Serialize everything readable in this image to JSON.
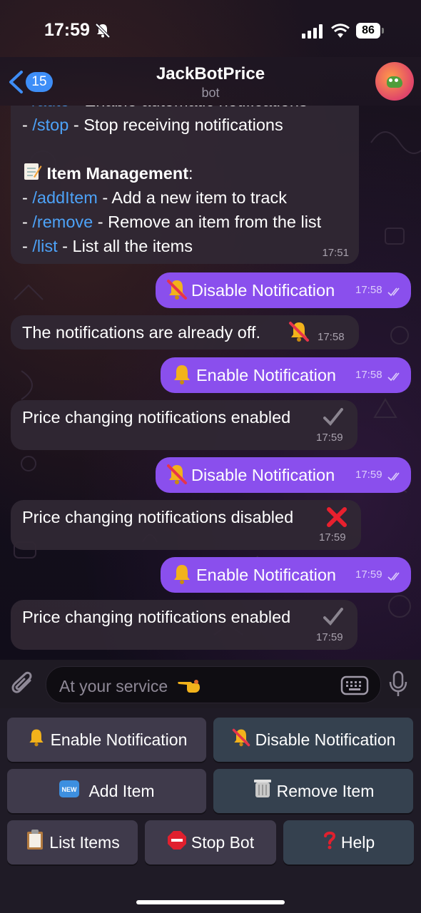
{
  "status_bar": {
    "time": "17:59",
    "battery": "86"
  },
  "header": {
    "back_count": "15",
    "title": "JackBotPrice",
    "subtitle": "bot"
  },
  "messages": {
    "help": {
      "line0_cmd": "/auto",
      "line0_text": " - Enable automatic notifications",
      "line1_cmd": "/stop",
      "line1_text": " - Stop receiving notifications",
      "section_title": "Item Management",
      "section_colon": ":",
      "line2_cmd": "/addItem",
      "line2_text": " - Add a new item to track",
      "line3_cmd": "/remove",
      "line3_text": " - Remove an item from the list",
      "line4_cmd": "/list",
      "line4_text": " - List all the items",
      "time": "17:51"
    },
    "m1": {
      "text": "Disable Notification",
      "time": "17:58"
    },
    "m2": {
      "text": "The notifications are already off.",
      "time": "17:58"
    },
    "m3": {
      "text": "Enable Notification",
      "time": "17:58"
    },
    "m4": {
      "text": "Price changing notifications enabled",
      "time": "17:59"
    },
    "m5": {
      "text": "Disable Notification",
      "time": "17:59"
    },
    "m6": {
      "text": "Price changing notifications disabled",
      "time": "17:59"
    },
    "m7": {
      "text": "Enable Notification",
      "time": "17:59"
    },
    "m8": {
      "text": "Price changing notifications enabled",
      "time": "17:59"
    }
  },
  "input": {
    "placeholder": "At your service"
  },
  "keyboard": {
    "enable": "Enable Notification",
    "disable": "Disable Notification",
    "add": "Add Item",
    "remove": "Remove Item",
    "list": "List Items",
    "stop": "Stop Bot",
    "help": "Help",
    "new_badge": "NEW"
  },
  "colors": {
    "outgoing_bubble": "#8a4fed",
    "incoming_bubble": "#302834",
    "link": "#4da2f7",
    "badge": "#3e8ef7"
  },
  "icons": [
    "silent-bell-icon",
    "signal-icon",
    "wifi-icon",
    "battery-icon",
    "back-chevron-icon",
    "bell-icon",
    "bell-slash-icon",
    "check-icon",
    "cross-icon",
    "memo-icon",
    "paperclip-icon",
    "keyboard-icon",
    "microphone-icon",
    "new-badge-icon",
    "trash-icon",
    "clipboard-icon",
    "stop-sign-icon",
    "question-icon",
    "pointing-hand-icon"
  ]
}
